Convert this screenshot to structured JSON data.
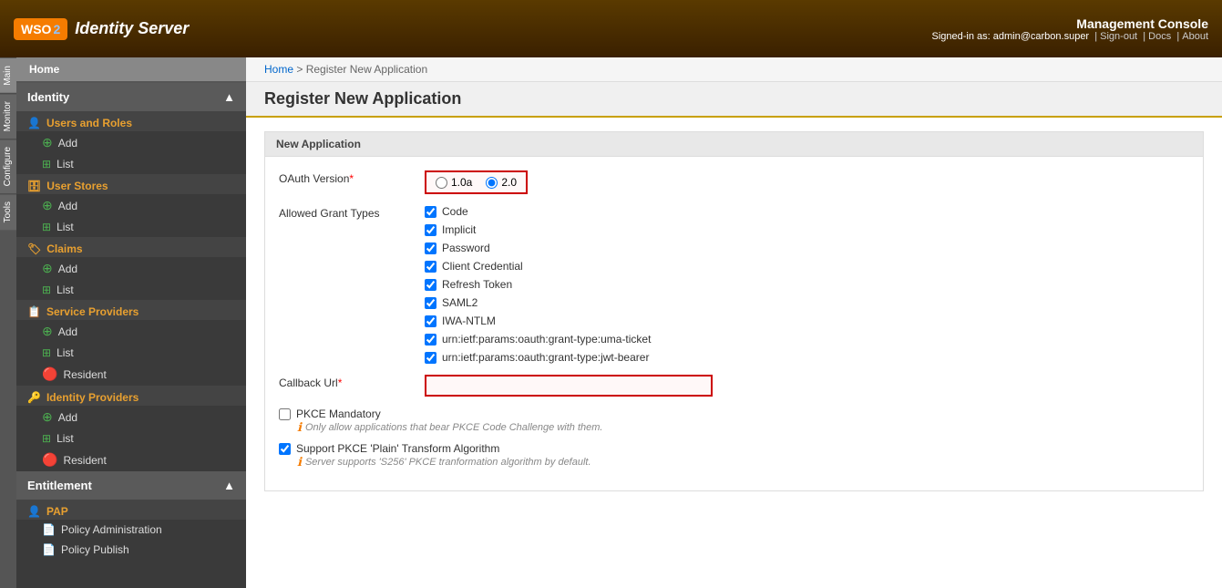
{
  "header": {
    "logo_wso": "WSO",
    "logo_two": "2",
    "logo_text": "Identity Server",
    "mgmt_title": "Management Console",
    "signed_in_label": "Signed-in as:",
    "signed_in_user": "admin@carbon.super",
    "sign_out": "Sign-out",
    "docs": "Docs",
    "about": "About"
  },
  "side_tabs": [
    {
      "label": "Main"
    },
    {
      "label": "Monitor"
    },
    {
      "label": "Configure"
    },
    {
      "label": "Tools"
    }
  ],
  "sidebar": {
    "home_label": "Home",
    "identity_label": "Identity",
    "sections": [
      {
        "group": "Users and Roles",
        "group_icon": "👤",
        "items": [
          "Add",
          "List"
        ]
      },
      {
        "group": "User Stores",
        "group_icon": "🗄",
        "items": [
          "Add",
          "List"
        ]
      },
      {
        "group": "Claims",
        "group_icon": "🏷",
        "items": [
          "Add",
          "List"
        ]
      },
      {
        "group": "Service Providers",
        "group_icon": "📋",
        "items": [
          "Add",
          "List",
          "Resident"
        ]
      },
      {
        "group": "Identity Providers",
        "group_icon": "🔑",
        "items": [
          "Add",
          "List",
          "Resident"
        ]
      }
    ],
    "entitlement_label": "Entitlement",
    "pap_label": "PAP",
    "pap_items": [
      "Policy Administration",
      "Policy Publish"
    ]
  },
  "breadcrumb": {
    "home": "Home",
    "separator": ">",
    "page": "Register New Application"
  },
  "page_title": "Register New Application",
  "form": {
    "section_label": "New Application",
    "oauth_version_label": "OAuth Version",
    "oauth_10a": "1.0a",
    "oauth_20": "2.0",
    "grant_types_label": "Allowed Grant Types",
    "grant_types": [
      "Code",
      "Implicit",
      "Password",
      "Client Credential",
      "Refresh Token",
      "SAML2",
      "IWA-NTLM",
      "urn:ietf:params:oauth:grant-type:uma-ticket",
      "urn:ietf:params:oauth:grant-type:jwt-bearer"
    ],
    "callback_url_label": "Callback Url",
    "pkce_mandatory_label": "PKCE Mandatory",
    "pkce_note": "Only allow applications that bear PKCE Code Challenge with them.",
    "pkce_plain_label": "Support PKCE 'Plain' Transform Algorithm",
    "pkce_plain_note": "Server supports 'S256' PKCE tranformation algorithm by default."
  }
}
